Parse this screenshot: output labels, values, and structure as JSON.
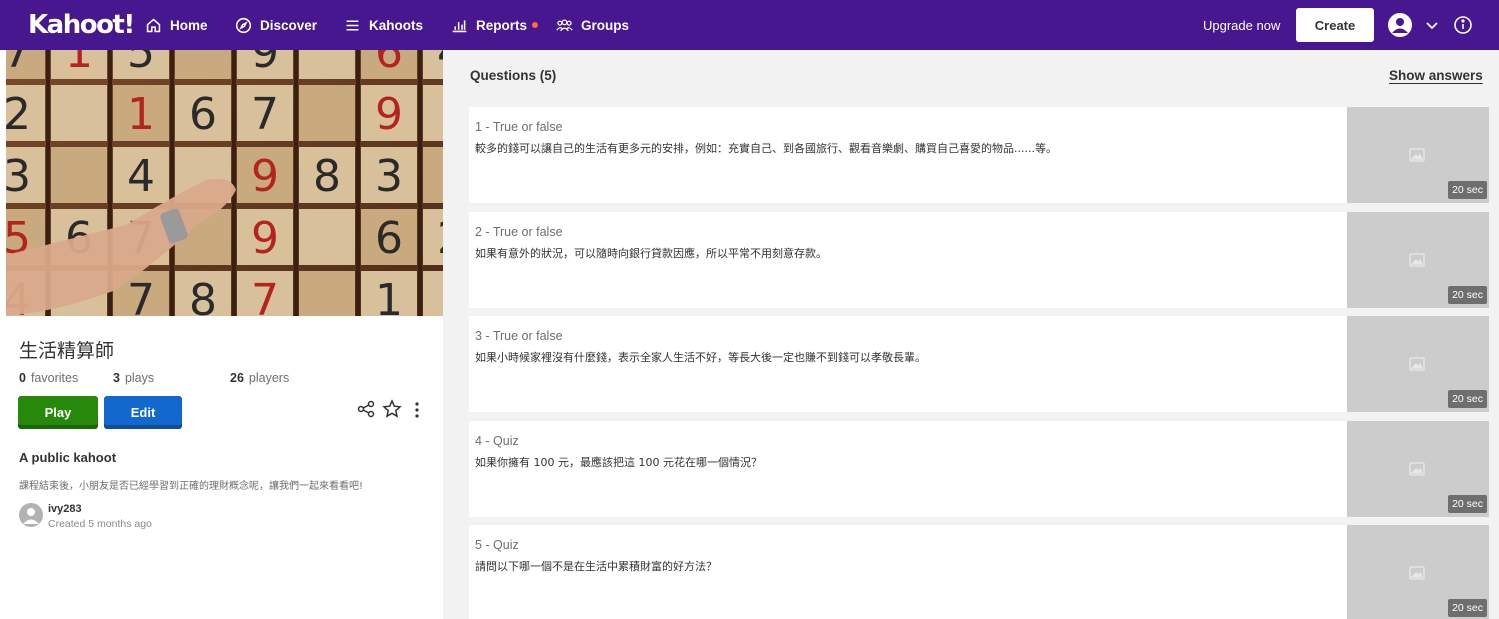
{
  "nav": {
    "logo": "Kahoot!",
    "home": "Home",
    "discover": "Discover",
    "kahoots": "Kahoots",
    "reports": "Reports",
    "groups": "Groups",
    "upgrade": "Upgrade now",
    "create": "Create",
    "icons": [
      "home-icon",
      "compass-icon",
      "list-icon",
      "bar-chart-icon",
      "groups-icon",
      "user-avatar-icon",
      "chevron-down-icon",
      "info-icon"
    ],
    "notification_color": "#ff6a3d"
  },
  "kahoot": {
    "title": "生活精算師",
    "favorites_count": "0",
    "favorites_label": "favorites",
    "plays_count": "3",
    "plays_label": "plays",
    "players_count": "26",
    "players_label": "players",
    "play_label": "Play",
    "edit_label": "Edit",
    "visibility": "A public kahoot",
    "description": "課程結束後，小朋友是否已經學習到正確的理財概念呢，讓我們一起來看看吧!",
    "creator": "ivy283",
    "created": "Created 5 months ago",
    "cover_numbers": [
      "7",
      "1",
      "5",
      "9",
      "6",
      "4",
      "2",
      "1",
      "6",
      "7",
      "9",
      "3",
      "4",
      "9",
      "8",
      "3",
      "5",
      "6",
      "7",
      "9",
      "6",
      "2",
      "4",
      "7",
      "8"
    ]
  },
  "questions_header": "Questions (5)",
  "show_answers": "Show answers",
  "questions": [
    {
      "type": "1 - True or false",
      "text": "較多的錢可以讓自己的生活有更多元的安排，例如：充實自己、到各國旅行、觀看音樂劇、購買自己喜愛的物品......等。",
      "time": "20 sec"
    },
    {
      "type": "2 - True or false",
      "text": "如果有意外的狀況，可以隨時向銀行貸款因應，所以平常不用刻意存款。",
      "time": "20 sec"
    },
    {
      "type": "3 - True or false",
      "text": "如果小時候家裡沒有什麼錢，表示全家人生活不好，等長大後一定也賺不到錢可以孝敬長輩。",
      "time": "20 sec"
    },
    {
      "type": "4 - Quiz",
      "text": "如果你擁有 100 元，最應該把這 100 元花在哪一個情況？",
      "time": "20 sec"
    },
    {
      "type": "5 - Quiz",
      "text": "請問以下哪一個不是在生活中累積財富的好方法？",
      "time": "20 sec"
    }
  ],
  "colors": {
    "brand_purple": "#46178f",
    "play_green": "#26890c",
    "edit_blue": "#1368ce",
    "thumb_gray": "#cccccc"
  }
}
